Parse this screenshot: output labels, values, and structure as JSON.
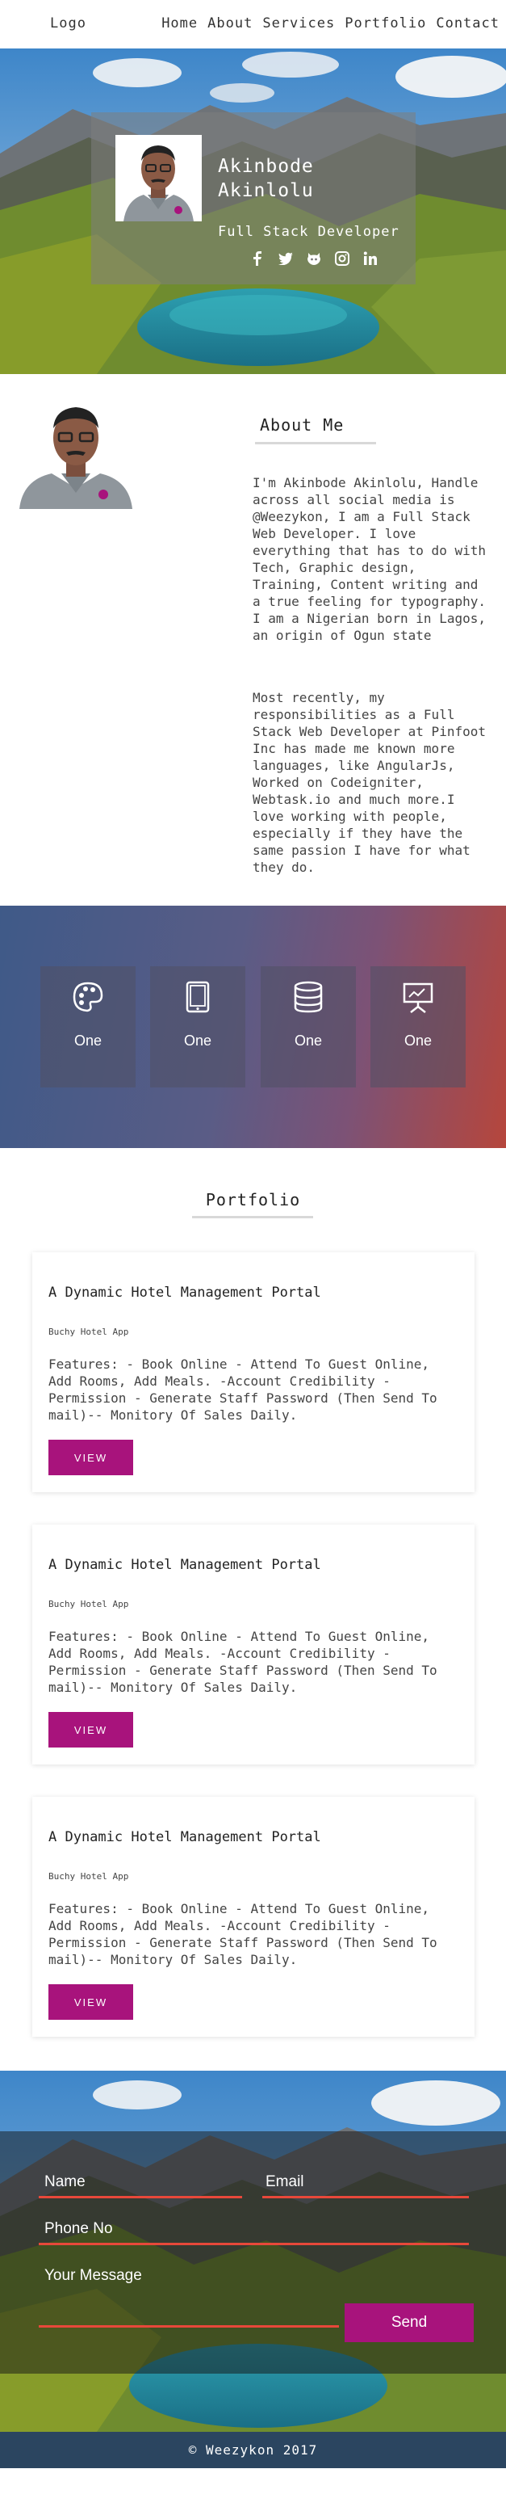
{
  "nav": {
    "logo": "Logo",
    "links": [
      "Home",
      "About",
      "Services",
      "Portfolio",
      "Contact"
    ]
  },
  "hero": {
    "name": "Akinbode Akinlolu",
    "role": "Full Stack Developer",
    "socials": [
      "facebook-icon",
      "twitter-icon",
      "github-icon",
      "instagram-icon",
      "linkedin-icon"
    ]
  },
  "about": {
    "title": "About Me",
    "paragraphs": [
      "I'm Akinbode Akinlolu, Handle across all social media is @Weezykon, I am a Full Stack Web Developer. I love everything that has to do with Tech, Graphic design, Training, Content writing and a true feeling for typography. I am a Nigerian born in Lagos, an origin of Ogun state",
      "Most recently, my responsibilities as a Full Stack Web Developer at Pinfoot Inc has made me known more languages, like AngularJs, Worked on Codeigniter, Webtask.io and much more.I love working with people, especially if they have the same passion I have for what they do."
    ]
  },
  "services": {
    "items": [
      {
        "icon": "palette-icon",
        "label": "One"
      },
      {
        "icon": "tablet-icon",
        "label": "One"
      },
      {
        "icon": "database-icon",
        "label": "One"
      },
      {
        "icon": "presentation-icon",
        "label": "One"
      }
    ]
  },
  "portfolio": {
    "title": "Portfolio",
    "cards": [
      {
        "title": "A Dynamic Hotel Management Portal",
        "subtitle": "Buchy Hotel App",
        "description": "Features: - Book Online - Attend To Guest Online, Add Rooms, Add Meals. -Account Credibility - Permission - Generate Staff Password (Then Send To mail)-- Monitory Of Sales Daily.",
        "button": "VIEW"
      },
      {
        "title": "A Dynamic Hotel Management Portal",
        "subtitle": "Buchy Hotel App",
        "description": "Features: - Book Online - Attend To Guest Online, Add Rooms, Add Meals. -Account Credibility - Permission - Generate Staff Password (Then Send To mail)-- Monitory Of Sales Daily.",
        "button": "VIEW"
      },
      {
        "title": "A Dynamic Hotel Management Portal",
        "subtitle": "Buchy Hotel App",
        "description": "Features: - Book Online - Attend To Guest Online, Add Rooms, Add Meals. -Account Credibility - Permission - Generate Staff Password (Then Send To mail)-- Monitory Of Sales Daily.",
        "button": "VIEW"
      }
    ]
  },
  "contact": {
    "name_label": "Name",
    "email_label": "Email",
    "phone_label": "Phone No",
    "message_label": "Your Message",
    "send_label": "Send"
  },
  "footer": {
    "text": "© Weezykon 2017"
  },
  "colors": {
    "accent": "#a8137c",
    "underline": "#e8483a",
    "footer": "#2b4560"
  }
}
